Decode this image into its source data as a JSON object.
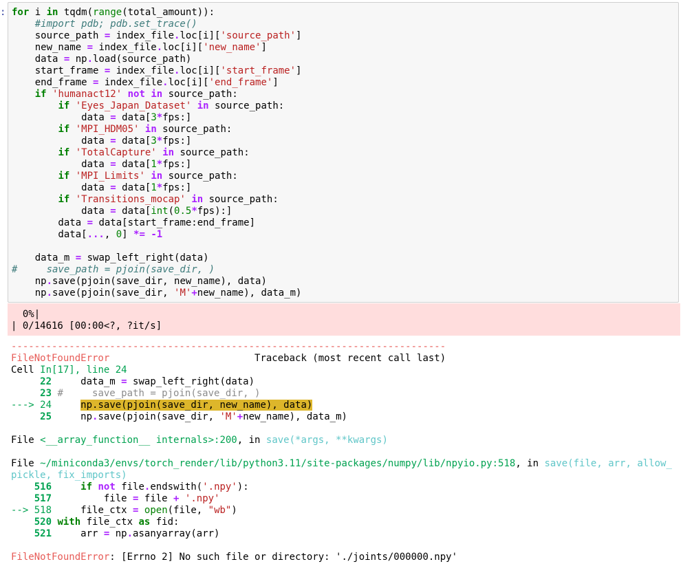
{
  "prompt": ":",
  "code_lines": [
    [
      {
        "t": "for",
        "c": "kw"
      },
      {
        "t": " i "
      },
      {
        "t": "in",
        "c": "kw"
      },
      {
        "t": " tqdm("
      },
      {
        "t": "range",
        "c": "bi"
      },
      {
        "t": "(total_amount)):"
      }
    ],
    [
      {
        "t": "    "
      },
      {
        "t": "#import pdb; pdb.set_trace()",
        "c": "cm"
      }
    ],
    [
      {
        "t": "    source_path "
      },
      {
        "t": "=",
        "c": "op"
      },
      {
        "t": " index_file"
      },
      {
        "t": ".",
        "c": "op"
      },
      {
        "t": "loc[i]["
      },
      {
        "t": "'source_path'",
        "c": "str"
      },
      {
        "t": "]"
      }
    ],
    [
      {
        "t": "    new_name "
      },
      {
        "t": "=",
        "c": "op"
      },
      {
        "t": " index_file"
      },
      {
        "t": ".",
        "c": "op"
      },
      {
        "t": "loc[i]["
      },
      {
        "t": "'new_name'",
        "c": "str"
      },
      {
        "t": "]"
      }
    ],
    [
      {
        "t": "    data "
      },
      {
        "t": "=",
        "c": "op"
      },
      {
        "t": " np"
      },
      {
        "t": ".",
        "c": "op"
      },
      {
        "t": "load(source_path)"
      }
    ],
    [
      {
        "t": "    start_frame "
      },
      {
        "t": "=",
        "c": "op"
      },
      {
        "t": " index_file"
      },
      {
        "t": ".",
        "c": "op"
      },
      {
        "t": "loc[i]["
      },
      {
        "t": "'start_frame'",
        "c": "str"
      },
      {
        "t": "]"
      }
    ],
    [
      {
        "t": "    end_frame "
      },
      {
        "t": "=",
        "c": "op"
      },
      {
        "t": " index_file"
      },
      {
        "t": ".",
        "c": "op"
      },
      {
        "t": "loc[i]["
      },
      {
        "t": "'end_frame'",
        "c": "str"
      },
      {
        "t": "]"
      }
    ],
    [
      {
        "t": "    "
      },
      {
        "t": "if",
        "c": "kw"
      },
      {
        "t": " "
      },
      {
        "t": "'humanact12'",
        "c": "str"
      },
      {
        "t": " "
      },
      {
        "t": "not",
        "c": "op"
      },
      {
        "t": " "
      },
      {
        "t": "in",
        "c": "op"
      },
      {
        "t": " source_path:"
      }
    ],
    [
      {
        "t": "        "
      },
      {
        "t": "if",
        "c": "kw"
      },
      {
        "t": " "
      },
      {
        "t": "'Eyes_Japan_Dataset'",
        "c": "str"
      },
      {
        "t": " "
      },
      {
        "t": "in",
        "c": "op"
      },
      {
        "t": " source_path:"
      }
    ],
    [
      {
        "t": "            data "
      },
      {
        "t": "=",
        "c": "op"
      },
      {
        "t": " data["
      },
      {
        "t": "3",
        "c": "num"
      },
      {
        "t": "*",
        "c": "op"
      },
      {
        "t": "fps:]"
      }
    ],
    [
      {
        "t": "        "
      },
      {
        "t": "if",
        "c": "kw"
      },
      {
        "t": " "
      },
      {
        "t": "'MPI_HDM05'",
        "c": "str"
      },
      {
        "t": " "
      },
      {
        "t": "in",
        "c": "op"
      },
      {
        "t": " source_path:"
      }
    ],
    [
      {
        "t": "            data "
      },
      {
        "t": "=",
        "c": "op"
      },
      {
        "t": " data["
      },
      {
        "t": "3",
        "c": "num"
      },
      {
        "t": "*",
        "c": "op"
      },
      {
        "t": "fps:]"
      }
    ],
    [
      {
        "t": "        "
      },
      {
        "t": "if",
        "c": "kw"
      },
      {
        "t": " "
      },
      {
        "t": "'TotalCapture'",
        "c": "str"
      },
      {
        "t": " "
      },
      {
        "t": "in",
        "c": "op"
      },
      {
        "t": " source_path:"
      }
    ],
    [
      {
        "t": "            data "
      },
      {
        "t": "=",
        "c": "op"
      },
      {
        "t": " data["
      },
      {
        "t": "1",
        "c": "num"
      },
      {
        "t": "*",
        "c": "op"
      },
      {
        "t": "fps:]"
      }
    ],
    [
      {
        "t": "        "
      },
      {
        "t": "if",
        "c": "kw"
      },
      {
        "t": " "
      },
      {
        "t": "'MPI_Limits'",
        "c": "str"
      },
      {
        "t": " "
      },
      {
        "t": "in",
        "c": "op"
      },
      {
        "t": " source_path:"
      }
    ],
    [
      {
        "t": "            data "
      },
      {
        "t": "=",
        "c": "op"
      },
      {
        "t": " data["
      },
      {
        "t": "1",
        "c": "num"
      },
      {
        "t": "*",
        "c": "op"
      },
      {
        "t": "fps:]"
      }
    ],
    [
      {
        "t": "        "
      },
      {
        "t": "if",
        "c": "kw"
      },
      {
        "t": " "
      },
      {
        "t": "'Transitions_mocap'",
        "c": "str"
      },
      {
        "t": " "
      },
      {
        "t": "in",
        "c": "op"
      },
      {
        "t": " source_path:"
      }
    ],
    [
      {
        "t": "            data "
      },
      {
        "t": "=",
        "c": "op"
      },
      {
        "t": " data["
      },
      {
        "t": "int",
        "c": "bi"
      },
      {
        "t": "("
      },
      {
        "t": "0.5",
        "c": "num"
      },
      {
        "t": "*",
        "c": "op"
      },
      {
        "t": "fps):]"
      }
    ],
    [
      {
        "t": "        data "
      },
      {
        "t": "=",
        "c": "op"
      },
      {
        "t": " data[start_frame:end_frame]"
      }
    ],
    [
      {
        "t": "        data["
      },
      {
        "t": "...",
        "c": "op"
      },
      {
        "t": ", "
      },
      {
        "t": "0",
        "c": "num"
      },
      {
        "t": "] "
      },
      {
        "t": "*=",
        "c": "op"
      },
      {
        "t": " "
      },
      {
        "t": "-1",
        "c": "op"
      }
    ],
    [
      {
        "t": ""
      }
    ],
    [
      {
        "t": "    data_m "
      },
      {
        "t": "=",
        "c": "op"
      },
      {
        "t": " swap_left_right(data)"
      }
    ],
    [
      {
        "t": "#     save_path = pjoin(save_dir, )",
        "c": "cm"
      }
    ],
    [
      {
        "t": "    np"
      },
      {
        "t": ".",
        "c": "op"
      },
      {
        "t": "save(pjoin(save_dir, new_name), data)"
      }
    ],
    [
      {
        "t": "    np"
      },
      {
        "t": ".",
        "c": "op"
      },
      {
        "t": "save(pjoin(save_dir, "
      },
      {
        "t": "'M'",
        "c": "str"
      },
      {
        "t": "+",
        "c": "op"
      },
      {
        "t": "new_name), data_m)"
      }
    ]
  ],
  "stderr_lines": [
    "  0%|",
    "| 0/14616 [00:00<?, ?it/s]"
  ],
  "traceback_lines": [
    [
      {
        "t": "---------------------------------------------------------------------------",
        "c": "red"
      }
    ],
    [
      {
        "t": "FileNotFoundError",
        "c": "red"
      },
      {
        "t": "                         Traceback (most recent call last)"
      }
    ],
    [
      {
        "t": "Cell "
      },
      {
        "t": "In[17], line 24",
        "c": "grn"
      }
    ],
    [
      {
        "t": "     "
      },
      {
        "t": "22",
        "c": "grb"
      },
      {
        "t": "     data_m "
      },
      {
        "t": "=",
        "c": "op"
      },
      {
        "t": " swap_left_right(data)"
      }
    ],
    [
      {
        "t": "     "
      },
      {
        "t": "23",
        "c": "grb"
      },
      {
        "t": " "
      },
      {
        "t": "#     save_path = pjoin(save_dir, )",
        "c": "gr"
      }
    ],
    [
      {
        "t": "---> 24",
        "c": "grn"
      },
      {
        "t": "     "
      },
      {
        "t": "np.save(pjoin(save_dir, new_name), data)",
        "c": "hl"
      }
    ],
    [
      {
        "t": "     "
      },
      {
        "t": "25",
        "c": "grb"
      },
      {
        "t": "     np"
      },
      {
        "t": ".",
        "c": "op"
      },
      {
        "t": "save(pjoin(save_dir, "
      },
      {
        "t": "'M'",
        "c": "str"
      },
      {
        "t": "+",
        "c": "op"
      },
      {
        "t": "new_name), data_m)"
      }
    ],
    [
      {
        "t": ""
      }
    ],
    [
      {
        "t": "File "
      },
      {
        "t": "<__array_function__ internals>:200",
        "c": "grn"
      },
      {
        "t": ", in "
      },
      {
        "t": "save",
        "c": "cy"
      },
      {
        "t": "(*args, **kwargs)",
        "c": "cy"
      }
    ],
    [
      {
        "t": ""
      }
    ],
    [
      {
        "t": "File "
      },
      {
        "t": "~/miniconda3/envs/torch_render/lib/python3.11/site-packages/numpy/lib/npyio.py:518",
        "c": "grn"
      },
      {
        "t": ", in "
      },
      {
        "t": "save",
        "c": "cy"
      },
      {
        "t": "(file, arr, allow_",
        "c": "cy"
      }
    ],
    [
      {
        "t": "pickle, fix_imports)",
        "c": "cy"
      }
    ],
    [
      {
        "t": "    "
      },
      {
        "t": "516",
        "c": "grb"
      },
      {
        "t": "     "
      },
      {
        "t": "if",
        "c": "kw"
      },
      {
        "t": " "
      },
      {
        "t": "not",
        "c": "op"
      },
      {
        "t": " file"
      },
      {
        "t": ".",
        "c": "op"
      },
      {
        "t": "endswith("
      },
      {
        "t": "'.npy'",
        "c": "str"
      },
      {
        "t": "):"
      }
    ],
    [
      {
        "t": "    "
      },
      {
        "t": "517",
        "c": "grb"
      },
      {
        "t": "         file "
      },
      {
        "t": "=",
        "c": "op"
      },
      {
        "t": " file "
      },
      {
        "t": "+",
        "c": "op"
      },
      {
        "t": " "
      },
      {
        "t": "'.npy'",
        "c": "str"
      }
    ],
    [
      {
        "t": "--> 518",
        "c": "grn"
      },
      {
        "t": "     file_ctx "
      },
      {
        "t": "=",
        "c": "op"
      },
      {
        "t": " "
      },
      {
        "t": "open",
        "c": "bi"
      },
      {
        "t": "(file, "
      },
      {
        "t": "\"wb\"",
        "c": "str"
      },
      {
        "t": ")"
      }
    ],
    [
      {
        "t": "    "
      },
      {
        "t": "520",
        "c": "grb"
      },
      {
        "t": " "
      },
      {
        "t": "with",
        "c": "kw"
      },
      {
        "t": " file_ctx "
      },
      {
        "t": "as",
        "c": "kw"
      },
      {
        "t": " fid:"
      }
    ],
    [
      {
        "t": "    "
      },
      {
        "t": "521",
        "c": "grb"
      },
      {
        "t": "     arr "
      },
      {
        "t": "=",
        "c": "op"
      },
      {
        "t": " np"
      },
      {
        "t": ".",
        "c": "op"
      },
      {
        "t": "asanyarray(arr)"
      }
    ],
    [
      {
        "t": ""
      }
    ],
    [
      {
        "t": "FileNotFoundError",
        "c": "red"
      },
      {
        "t": ": [Errno 2] No such file or directory: './joints/000000.npy'"
      }
    ]
  ]
}
